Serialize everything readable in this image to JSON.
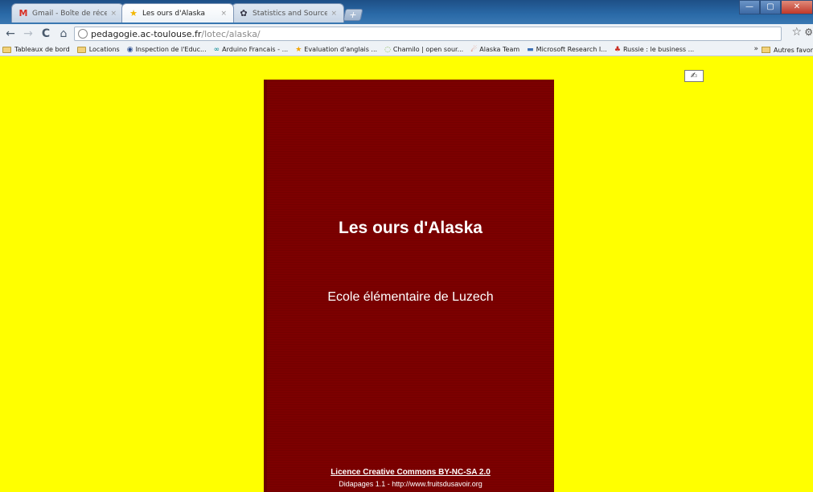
{
  "browser": {
    "tabs": [
      {
        "title": "Gmail - Boîte de réceptio...",
        "icon": "gmail-icon",
        "active": false
      },
      {
        "title": "Les ours d'Alaska",
        "icon": "star-icon",
        "active": true
      },
      {
        "title": "Statistics and Sources | K...",
        "icon": "gear-icon",
        "active": false
      }
    ],
    "close_glyph": "×",
    "newtab_glyph": "+",
    "window_buttons": {
      "minimize": "—",
      "maximize": "▢",
      "close": "✕"
    }
  },
  "toolbar": {
    "back": "←",
    "forward": "→",
    "reload": "C",
    "home": "⌂",
    "url_host": "pedagogie.ac-toulouse.fr",
    "url_path": "/lotec/alaska/",
    "star": "☆",
    "wrench": "⚙"
  },
  "bookmarks": {
    "items": [
      {
        "label": "Tableaux de bord",
        "type": "folder"
      },
      {
        "label": "Locations",
        "type": "folder"
      },
      {
        "label": "Inspection de l'Educ...",
        "type": "site",
        "icon": "◉"
      },
      {
        "label": "Arduino Francais - ...",
        "type": "site",
        "icon": "∞"
      },
      {
        "label": "Evaluation d'anglais ...",
        "type": "site",
        "icon": "★"
      },
      {
        "label": "Chamilo | open sour...",
        "type": "site",
        "icon": "◌"
      },
      {
        "label": "Alaska Team",
        "type": "site",
        "icon": "☄"
      },
      {
        "label": "Microsoft Research I...",
        "type": "site",
        "icon": "▬"
      },
      {
        "label": "Russie : le business ...",
        "type": "site",
        "icon": "♣"
      }
    ],
    "more": "»",
    "other_label": "Autres favor"
  },
  "page": {
    "background": "#ffff00",
    "cover_color": "#7c0000",
    "title": "Les ours d'Alaska",
    "subtitle": "Ecole élémentaire de Luzech",
    "licence": "Licence Creative Commons BY-NC-SA 2.0",
    "credits": "Didapages 1.1 - http://www.fruitsdusavoir.org",
    "page_button_glyph": "✍"
  }
}
